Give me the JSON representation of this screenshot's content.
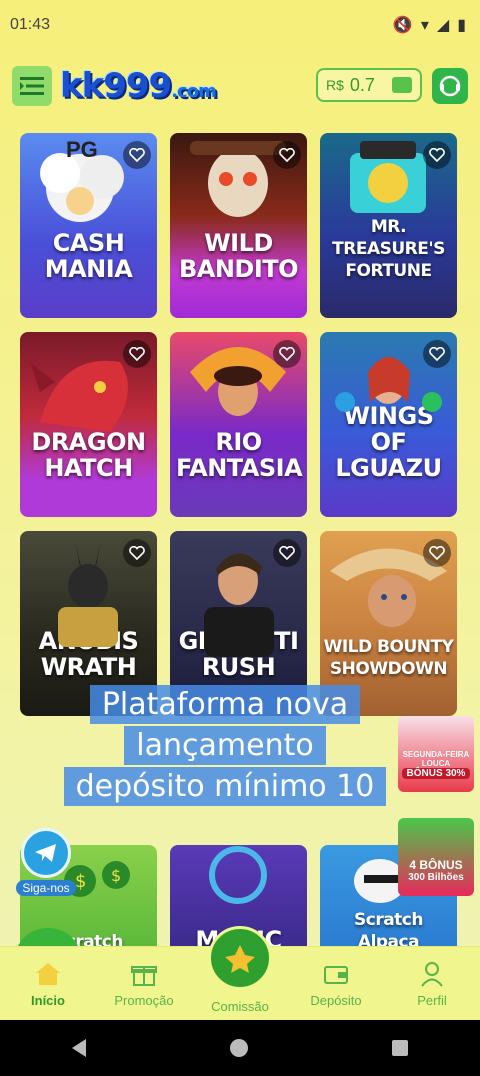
{
  "status": {
    "time": "01:43"
  },
  "header": {
    "logo_main": "kk999",
    "logo_suffix": ".com",
    "balance_currency": "R$",
    "balance_value": "0.7"
  },
  "games": [
    {
      "title": "CASH MANIA",
      "extra": "PG"
    },
    {
      "title": "WILD BANDITO"
    },
    {
      "title": "MR. TREASURE'S FORTUNE"
    },
    {
      "title": "DRAGON HATCH"
    },
    {
      "title": "RIO FANTASIA"
    },
    {
      "title": "WINGS OF LGUAZU"
    },
    {
      "title": "ANUBIS WRATH"
    },
    {
      "title": "GRAFFITI RUSH"
    },
    {
      "title": "WILD BOUNTY SHOWDOWN"
    },
    {
      "title": "Scratch"
    },
    {
      "title": "MAGIC"
    },
    {
      "title": "Scratch Alpaca"
    }
  ],
  "promo_overlay": [
    "Plataforma nova",
    "lançamento",
    "depósito mínimo 10"
  ],
  "side_badges": {
    "badge1_line1": "SEGUNDA-FEIRA",
    "badge1_line2": "LOUCA",
    "badge1_line3": "BÔNUS 30%",
    "badge2_line1": "4 BÔNUS",
    "badge2_line2": "300 Bilhões"
  },
  "follow": {
    "label": "Siga-nos"
  },
  "nav": {
    "home": "Início",
    "promo": "Promoção",
    "commission": "Comissão",
    "deposit": "Depósito",
    "profile": "Perfil"
  },
  "colors": {
    "accent_green": "#39b43a",
    "background": "#f6ef7a"
  }
}
